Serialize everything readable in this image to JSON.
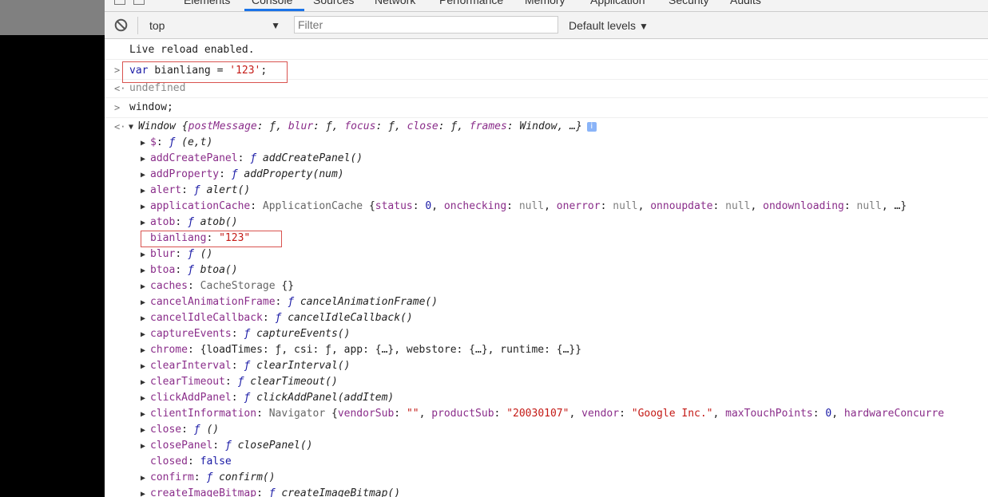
{
  "tabs": [
    {
      "label": "Elements"
    },
    {
      "label": "Console"
    },
    {
      "label": "Sources"
    },
    {
      "label": "Network"
    },
    {
      "label": "Performance"
    },
    {
      "label": "Memory"
    },
    {
      "label": "Application"
    },
    {
      "label": "Security"
    },
    {
      "label": "Audits"
    }
  ],
  "toolbar": {
    "context": "top",
    "caret": "▼",
    "filter_placeholder": "Filter",
    "levels": "Default levels"
  },
  "console": {
    "live_reload": "Live reload enabled.",
    "cmd1": {
      "var": "var",
      "name": "bianliang",
      "eq": " = ",
      "value": "'123'",
      "semi": ";"
    },
    "result1": "undefined",
    "cmd2": "window;",
    "window_summary": {
      "name": "Window",
      "open": " {",
      "props": [
        {
          "key": "postMessage",
          "val": "ƒ"
        },
        {
          "key": "blur",
          "val": "ƒ"
        },
        {
          "key": "focus",
          "val": "ƒ"
        },
        {
          "key": "close",
          "val": "ƒ"
        },
        {
          "key": "frames",
          "val": "Window"
        }
      ],
      "close": ", …}",
      "info": "i"
    },
    "properties": [
      {
        "key": "$",
        "f": "ƒ",
        "text": "(e,t)",
        "expandable": true
      },
      {
        "key": "addCreatePanel",
        "f": "ƒ",
        "text": "addCreatePanel()",
        "expandable": true
      },
      {
        "key": "addProperty",
        "f": "ƒ",
        "text": "addProperty(num)",
        "expandable": true
      },
      {
        "key": "alert",
        "f": "ƒ",
        "text": "alert()",
        "expandable": true
      },
      {
        "key": "applicationCache",
        "obj": "ApplicationCache",
        "inner": [
          {
            "k": "status",
            "v": "0",
            "t": "num"
          },
          {
            "k": "onchecking",
            "v": "null",
            "t": "null"
          },
          {
            "k": "onerror",
            "v": "null",
            "t": "null"
          },
          {
            "k": "onnoupdate",
            "v": "null",
            "t": "null"
          },
          {
            "k": "ondownloading",
            "v": "null",
            "t": "null"
          }
        ],
        "tail": ", …}",
        "expandable": true
      },
      {
        "key": "atob",
        "f": "ƒ",
        "text": "atob()",
        "expandable": true
      },
      {
        "key": "bianliang",
        "str": "\"123\"",
        "expandable": false
      },
      {
        "key": "blur",
        "f": "ƒ",
        "text": "()",
        "expandable": true
      },
      {
        "key": "btoa",
        "f": "ƒ",
        "text": "btoa()",
        "expandable": true
      },
      {
        "key": "caches",
        "obj": "CacheStorage",
        "plain": " {}",
        "expandable": true
      },
      {
        "key": "cancelAnimationFrame",
        "f": "ƒ",
        "text": "cancelAnimationFrame()",
        "expandable": true
      },
      {
        "key": "cancelIdleCallback",
        "f": "ƒ",
        "text": "cancelIdleCallback()",
        "expandable": true
      },
      {
        "key": "captureEvents",
        "f": "ƒ",
        "text": "captureEvents()",
        "expandable": true
      },
      {
        "key": "chrome",
        "plain": "{loadTimes: ƒ, csi: ƒ, app: {…}, webstore: {…}, runtime: {…}}",
        "expandable": true
      },
      {
        "key": "clearInterval",
        "f": "ƒ",
        "text": "clearInterval()",
        "expandable": true
      },
      {
        "key": "clearTimeout",
        "f": "ƒ",
        "text": "clearTimeout()",
        "expandable": true
      },
      {
        "key": "clickAddPanel",
        "f": "ƒ",
        "text": "clickAddPanel(addItem)",
        "expandable": true
      },
      {
        "key": "clientInformation",
        "obj": "Navigator",
        "inner": [
          {
            "k": "vendorSub",
            "v": "\"\"",
            "t": "str"
          },
          {
            "k": "productSub",
            "v": "\"20030107\"",
            "t": "str"
          },
          {
            "k": "vendor",
            "v": "\"Google Inc.\"",
            "t": "str"
          },
          {
            "k": "maxTouchPoints",
            "v": "0",
            "t": "num"
          },
          {
            "k": "hardwareConcurre",
            "v": "",
            "t": "none"
          }
        ],
        "tail": "",
        "expandable": true
      },
      {
        "key": "close",
        "f": "ƒ",
        "text": "()",
        "expandable": true
      },
      {
        "key": "closePanel",
        "f": "ƒ",
        "text": "closePanel()",
        "expandable": true
      },
      {
        "key": "closed",
        "bool": "false",
        "expandable": false
      },
      {
        "key": "confirm",
        "f": "ƒ",
        "text": "confirm()",
        "expandable": true
      },
      {
        "key": "createImageBitmap",
        "f": "ƒ",
        "text": "createImageBitmap()",
        "expandable": true
      }
    ]
  },
  "colors": {
    "highlight_box": "#d9534f",
    "accent": "#1a73e8"
  }
}
